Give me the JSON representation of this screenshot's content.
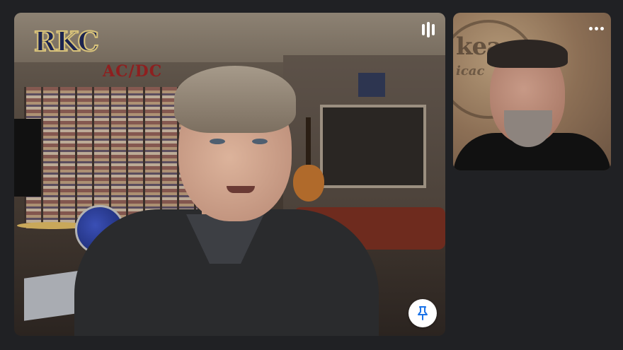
{
  "main_tile": {
    "logo_text": "RKC",
    "wall_sign": "AC/DC",
    "audio_icon": "audio-level-icon",
    "pin_icon": "pin-icon"
  },
  "side_tile": {
    "wall_text_line1": "kea",
    "wall_text_line2": "icac",
    "menu_icon": "more-options-icon"
  },
  "colors": {
    "background": "#202124",
    "pin_button_bg": "#ffffff",
    "pin_icon": "#1a73e8"
  }
}
